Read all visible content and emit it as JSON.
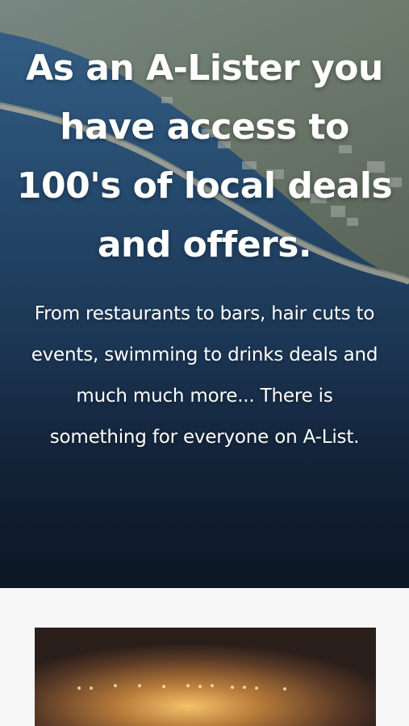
{
  "hero": {
    "title": "As an A-Lister you have access to 100's of local deals and offers.",
    "description": "From restaurants to bars, hair cuts to events, swimming to drinks deals and much much more... There is something for everyone on A-List."
  },
  "colors": {
    "hero_overlay": "#16243a",
    "text": "#ffffff",
    "section_bg": "#f7f7f7"
  }
}
